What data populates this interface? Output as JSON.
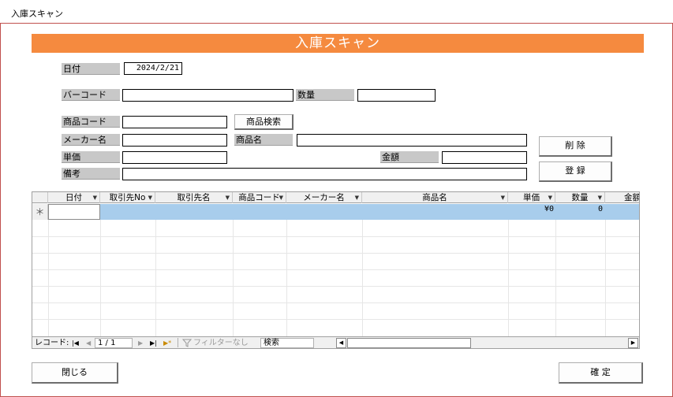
{
  "tab": {
    "label": "入庫スキャン"
  },
  "header": {
    "title": "入庫スキャン"
  },
  "form": {
    "date_label": "日付",
    "date_value": "2024/2/21",
    "barcode_label": "バーコード",
    "barcode_value": "",
    "quantity_label": "数量",
    "quantity_value": "",
    "product_code_label": "商品コード",
    "product_code_value": "",
    "product_search_button": "商品検索",
    "maker_label": "メーカー名",
    "maker_value": "",
    "product_name_label": "商品名",
    "product_name_value": "",
    "unit_price_label": "単価",
    "unit_price_value": "",
    "amount_label": "金額",
    "amount_value": "",
    "note_label": "備考",
    "note_value": "",
    "delete_button": "削 除",
    "register_button": "登 録"
  },
  "grid": {
    "columns": [
      "日付",
      "取引先No",
      "取引先名",
      "商品コード",
      "メーカー名",
      "商品名",
      "単価",
      "数量",
      "金額"
    ],
    "new_row": {
      "marker": "＊",
      "unit_price": "¥0",
      "quantity": "0"
    }
  },
  "navigator": {
    "record_label": "レコード:",
    "first": "|◀",
    "prev": "◀",
    "position": "1 / 1",
    "next": "▶",
    "last": "▶|",
    "new": "▶*",
    "filter_label": "フィルターなし",
    "search_label": "検索"
  },
  "footer": {
    "close_button": "閉じる",
    "confirm_button": "確 定"
  }
}
